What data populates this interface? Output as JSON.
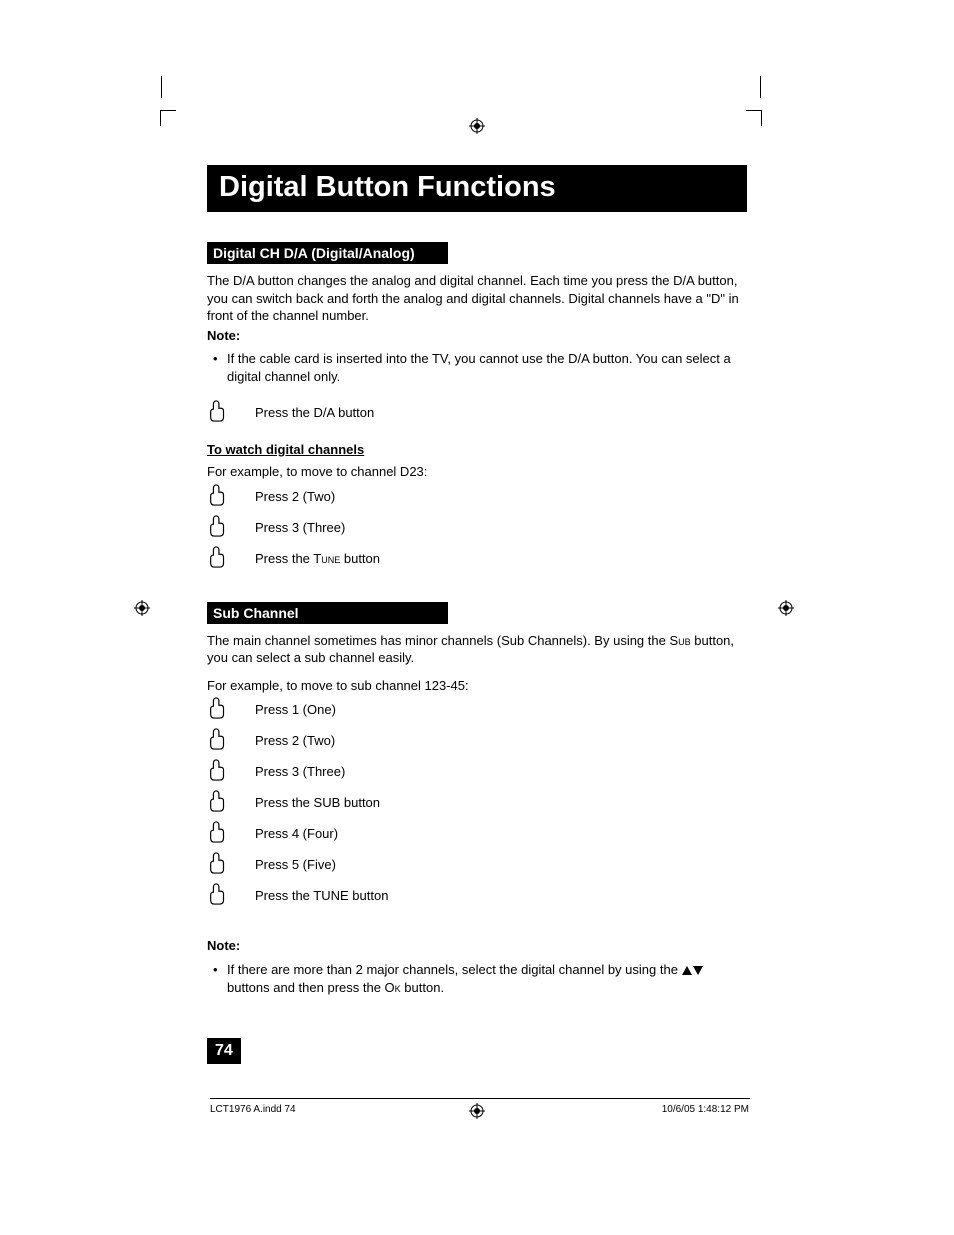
{
  "title": "Digital Button Functions",
  "section1": {
    "heading": "Digital CH D/A (Digital/Analog)",
    "intro": "The D/A button changes the analog and digital channel.  Each time you press the D/A button, you can switch back and forth the analog and digital channels.  Digital channels have a \"D\" in front of the channel number.",
    "note_label": "Note:",
    "note_bullet": "If the cable card is inserted into the TV, you cannot use the D/A button.  You can select a digital channel only.",
    "step_single": "Press the D/A button",
    "sub_heading": "To watch digital channels",
    "example_intro": "For example, to move to channel D23:",
    "steps": [
      "Press 2 (Two)",
      "Press 3 (Three)"
    ],
    "step_tune_prefix": "Press the T",
    "step_tune_sc": "une",
    "step_tune_suffix": " button"
  },
  "section2": {
    "heading": "Sub Channel",
    "intro_prefix": "The main channel sometimes has minor channels (Sub Channels).  By using the S",
    "intro_sc": "ub",
    "intro_suffix": " button, you can select a sub channel easily.",
    "example_intro": "For example, to move to sub channel 123-45:",
    "steps": [
      "Press 1 (One)",
      "Press 2 (Two)",
      "Press 3 (Three)",
      "Press the SUB button",
      "Press 4 (Four)",
      "Press 5 (Five)",
      "Press the TUNE button"
    ],
    "note_label": "Note:",
    "note_bullet_prefix": "If there are more than 2 major channels, select the digital channel by using the ",
    "note_bullet_mid": " buttons and then press the O",
    "note_bullet_sc": "k",
    "note_bullet_suffix": " button."
  },
  "page_number": "74",
  "footer": {
    "left": "LCT1976 A.indd   74",
    "right": "10/6/05   1:48:12 PM"
  }
}
